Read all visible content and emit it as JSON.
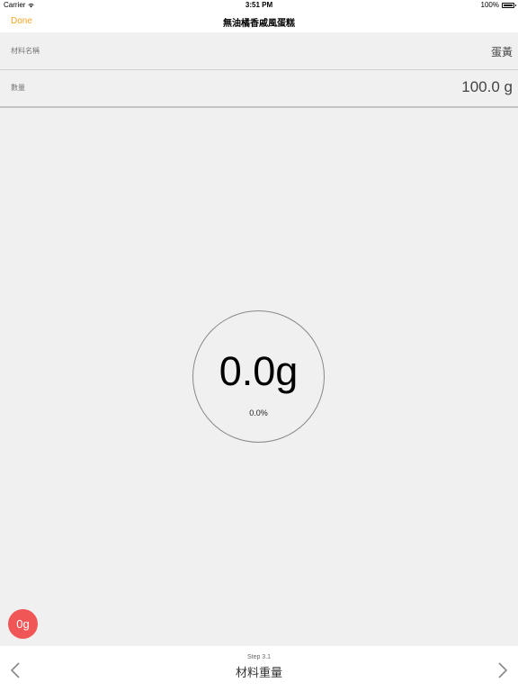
{
  "status_bar": {
    "carrier": "Carrier",
    "time": "3:51 PM",
    "battery": "100%"
  },
  "nav": {
    "done_label": "Done",
    "title": "無油橘香戚風蛋糕"
  },
  "form": {
    "name_label": "材料名稱",
    "name_value": "蛋黃",
    "qty_label": "數量",
    "qty_value": "100.0 g"
  },
  "scale": {
    "weight": "0.0g",
    "percent": "0.0%"
  },
  "tare_button": {
    "label": "0g"
  },
  "bottom": {
    "step_label": "Step 3.1",
    "step_title": "材料重量"
  },
  "icons": {
    "wifi": "wifi-icon",
    "battery": "battery-icon",
    "prev": "chevron-left-icon",
    "next": "chevron-right-icon"
  },
  "colors": {
    "accent": "#f5a623",
    "tare": "#f05656",
    "background": "#f0f0f0"
  }
}
